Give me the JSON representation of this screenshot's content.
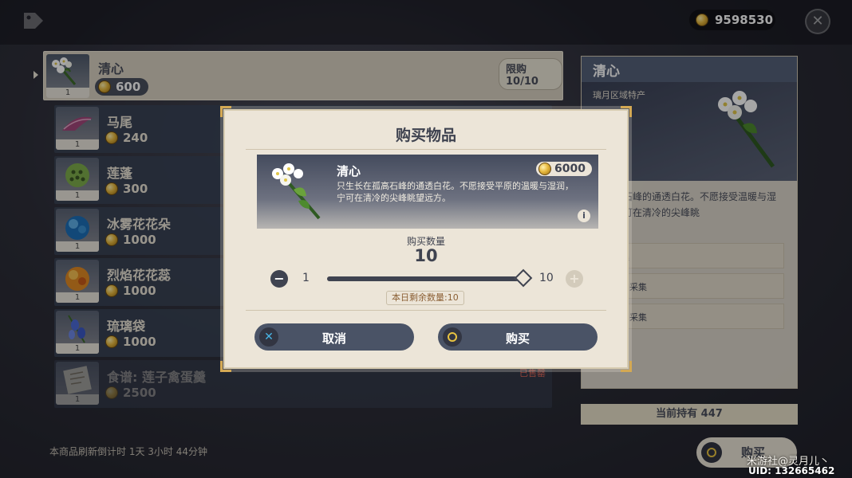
{
  "header": {
    "currency_amount": "9598530"
  },
  "shop_items": [
    {
      "name": "清心",
      "price": "600",
      "qty": "1",
      "limit": "限购 10/10",
      "selected": true
    },
    {
      "name": "马尾",
      "price": "240",
      "qty": "1"
    },
    {
      "name": "莲蓬",
      "price": "300",
      "qty": "1"
    },
    {
      "name": "冰雾花花朵",
      "price": "1000",
      "qty": "1"
    },
    {
      "name": "烈焰花花蕊",
      "price": "1000",
      "qty": "1"
    },
    {
      "name": "琉璃袋",
      "price": "1000",
      "qty": "1"
    },
    {
      "name": "食谱: 莲子禽蛋羹",
      "price": "2500",
      "qty": "1",
      "sold_label": "已售罄"
    }
  ],
  "refresh_text": "本商品刷新倒计时 1天 3小时 44分钟",
  "detail": {
    "title": "清心",
    "region": "璃月区域特产",
    "description": "在孤高石峰的通透白花。不愿接受温暖与湿润，宁可在清冷的尖峰眺",
    "sources": [
      "端采集",
      "绝云间采集",
      "孤云阁采集"
    ],
    "held": "当前持有 447",
    "buy_label": "购买"
  },
  "dialog": {
    "title": "购买物品",
    "item_name": "清心",
    "item_cost": "6000",
    "item_description": "只生长在孤高石峰的通透白花。不愿接受平原的温暖与湿润，宁可在清冷的尖峰眺望远方。",
    "qty_label": "购买数量",
    "qty_value": "10",
    "min": "1",
    "max": "10",
    "slider_fraction": 1.0,
    "remaining": "本日剩余数量:10",
    "cancel_label": "取消",
    "buy_label": "购买"
  },
  "footer": {
    "watermark": "米游社@灵月儿丶",
    "uid": "UID: 132665462"
  },
  "colors": {
    "accent_gold": "#e8c341",
    "panel_dark": "#3f4350",
    "cream": "#ece5d8",
    "sold_red": "#e0675a",
    "cancel_blue": "#48b5e6"
  }
}
